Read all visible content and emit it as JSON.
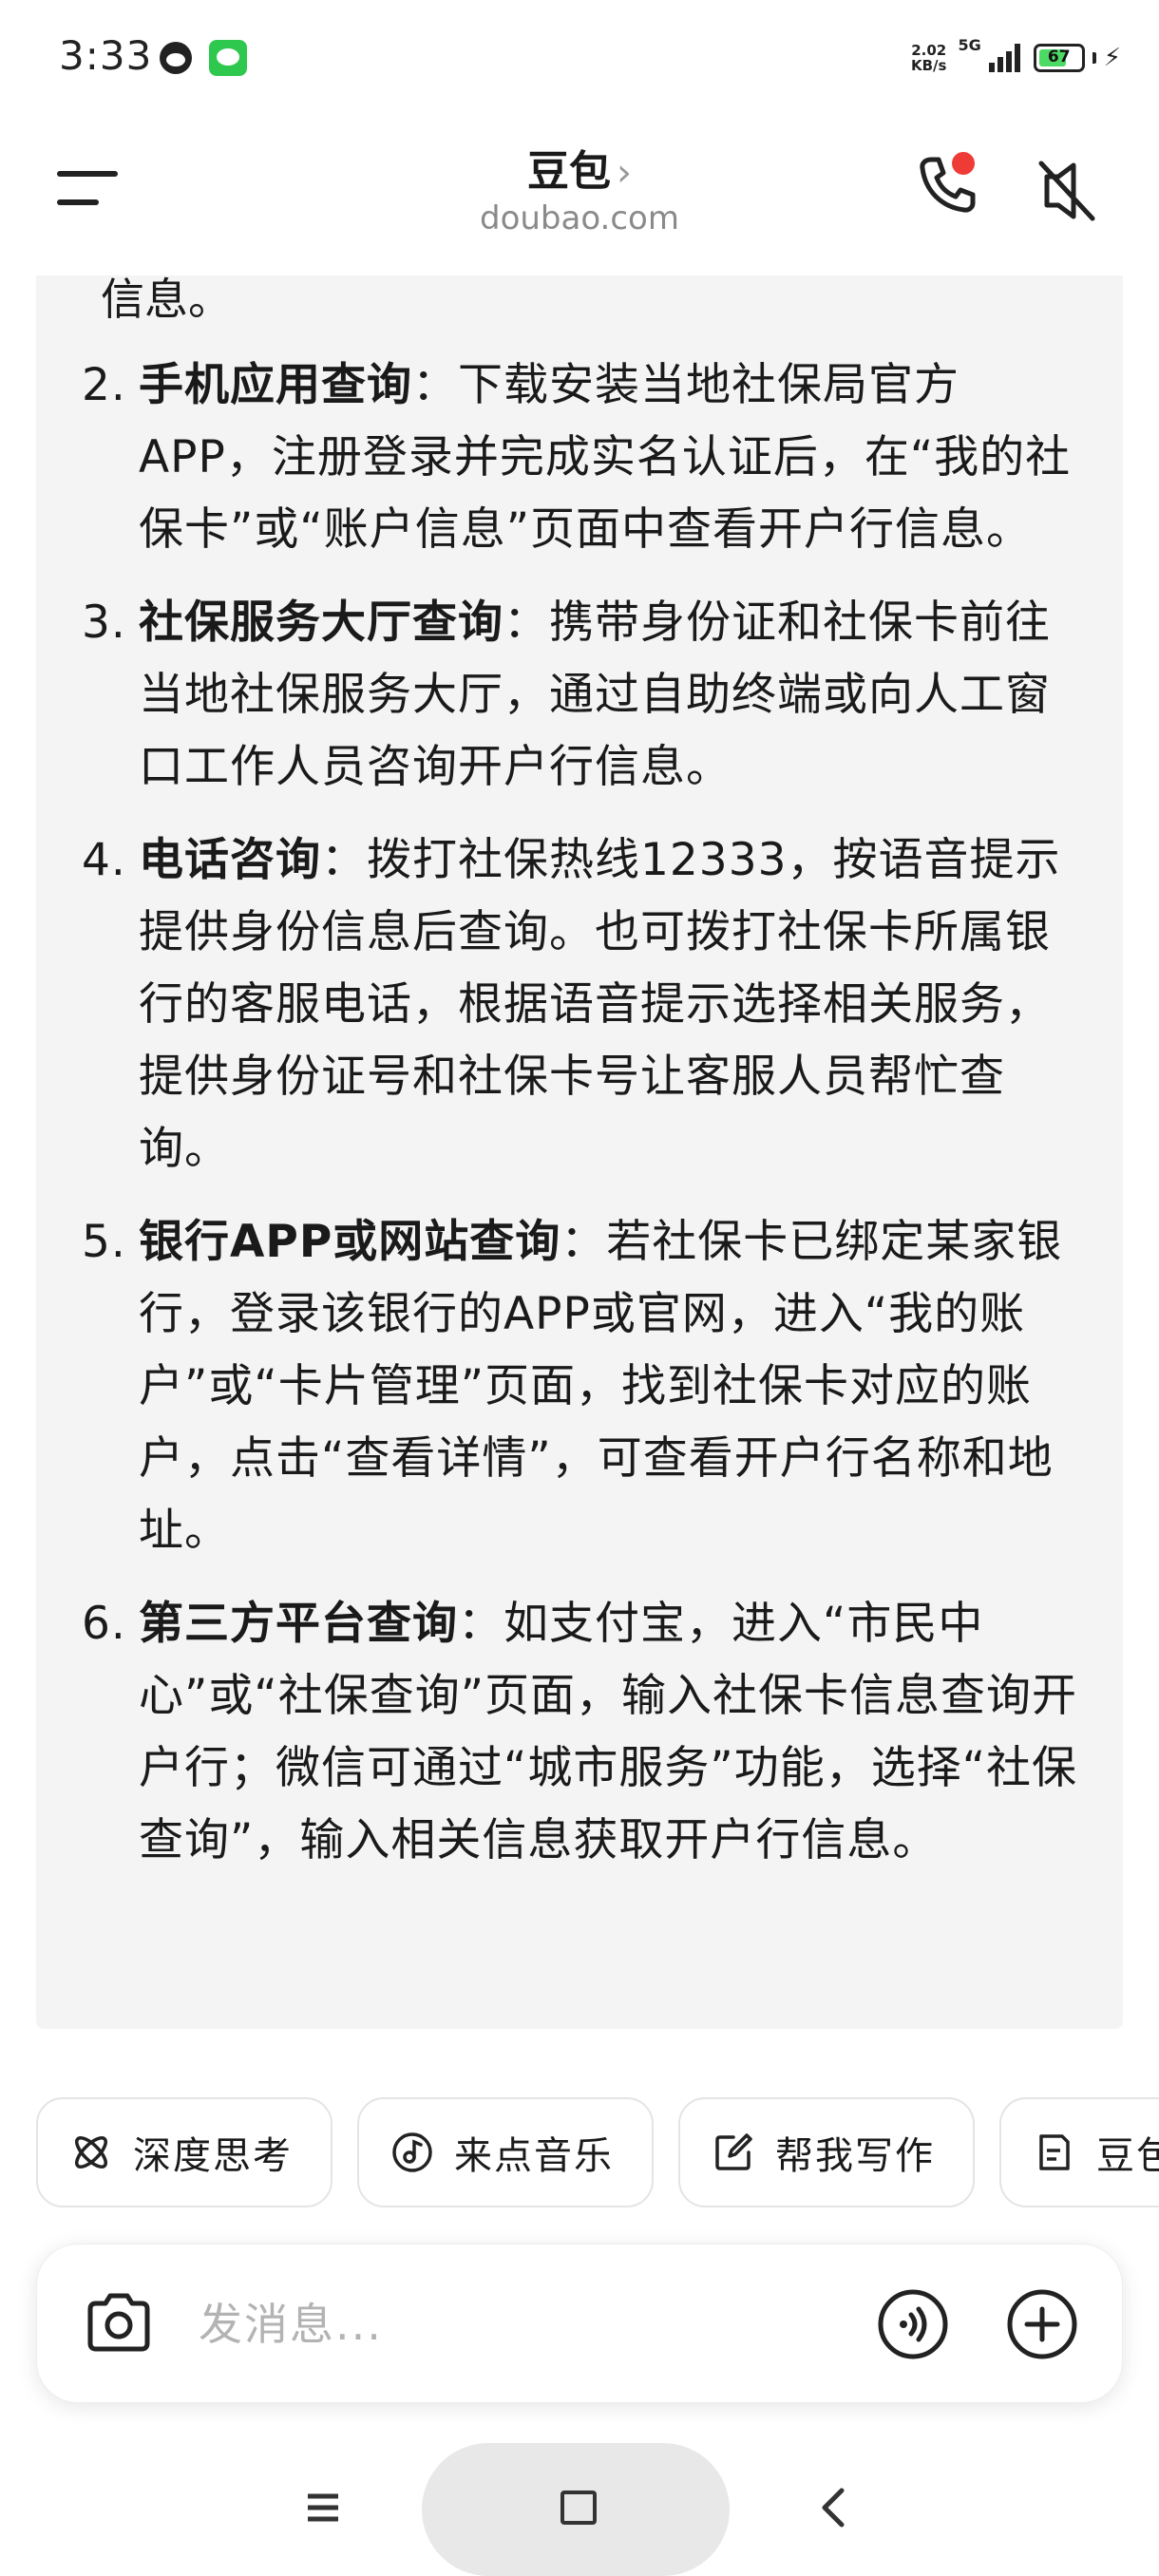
{
  "status_bar": {
    "time": "3:33",
    "net_speed_value": "2.02",
    "net_speed_unit": "KB/s",
    "network_type": "5G",
    "battery_level": "67",
    "battery_percent": 67,
    "icons": [
      "qq-icon",
      "wechat-icon",
      "signal-icon",
      "battery-icon",
      "charging-icon"
    ]
  },
  "header": {
    "title": "豆包",
    "title_chevron": "›",
    "subtitle": "doubao.com",
    "call_has_notification": true,
    "accent_red": "#ef3b36"
  },
  "answer": {
    "fragment": "信息。",
    "items": [
      {
        "number": "2.",
        "title": "手机应用查询",
        "body": "：下载安装当地社保局官方APP，注册登录并完成实名认证后，在“我的社保卡”或“账户信息”页面中查看开户行信息。"
      },
      {
        "number": "3.",
        "title": "社保服务大厅查询",
        "body": "：携带身份证和社保卡前往当地社保服务大厅，通过自助终端或向人工窗口工作人员咨询开户行信息。"
      },
      {
        "number": "4.",
        "title": "电话咨询",
        "body": "：拨打社保热线12333，按语音提示提供身份信息后查询。也可拨打社保卡所属银行的客服电话，根据语音提示选择相关服务，提供身份证号和社保卡号让客服人员帮忙查询。"
      },
      {
        "number": "5.",
        "title": "银行APP或网站查询",
        "body": "：若社保卡已绑定某家银行，登录该银行的APP或官网，进入“我的账户”或“卡片管理”页面，找到社保卡对应的账户，点击“查看详情”，可查看开户行名称和地址。"
      },
      {
        "number": "6.",
        "title": "第三方平台查询",
        "body": "：如支付宝，进入“市民中心”或“社保查询”页面，输入社保卡信息查询开户行；微信可通过“城市服务”功能，选择“社保查询”，输入相关信息获取开户行信息。"
      }
    ]
  },
  "chips": [
    {
      "label": "深度思考",
      "icon": "atom-icon"
    },
    {
      "label": "来点音乐",
      "icon": "music-icon"
    },
    {
      "label": "帮我写作",
      "icon": "edit-icon"
    },
    {
      "label": "豆包",
      "icon": "document-icon"
    }
  ],
  "input": {
    "placeholder": "发消息...",
    "value": ""
  },
  "nav": {
    "icons": [
      "menu-icon",
      "home-icon",
      "back-icon"
    ]
  }
}
